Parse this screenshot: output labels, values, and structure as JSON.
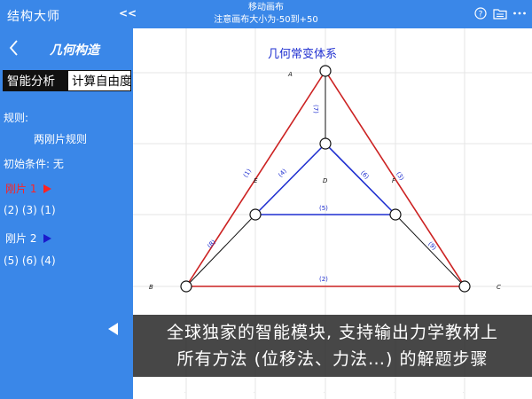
{
  "app": {
    "title": "结构大师",
    "collapse": "<<",
    "canvas_hint_title": "移动画布",
    "canvas_hint_sub": "注意画布大小为-50到+50"
  },
  "toolbar_icons": [
    "help-icon",
    "folder-icon",
    "more-icon"
  ],
  "sidebar": {
    "title": "几何构造",
    "tab_analysis": "智能分析",
    "tab_dof": "计算自由度",
    "rule_label": "规则:",
    "rule_value": "两刚片规则",
    "initial_label": "初始条件: 无",
    "rigid1_label": "刚片 1",
    "rigid1_members": "(2) (3) (1)",
    "rigid2_label": "刚片 2",
    "rigid2_members": "(5) (6) (4)"
  },
  "diagram": {
    "title": "几何常变体系",
    "nodes": {
      "A": "A",
      "B": "B",
      "C": "C",
      "D": "D",
      "E": "E",
      "F": "F"
    },
    "members": [
      "(1)",
      "(2)",
      "(3)",
      "(4)",
      "(5)",
      "(6)",
      "(7)",
      "(8)",
      "(9)"
    ],
    "colors": {
      "rigid1": "#cc2222",
      "rigid2": "#1f2fd0",
      "link": "#111111"
    }
  },
  "banner": {
    "line1": "全球独家的智能模块, 支持输出力学教材上",
    "line2": "所有方法 (位移法、力法…) 的解题步骤"
  }
}
